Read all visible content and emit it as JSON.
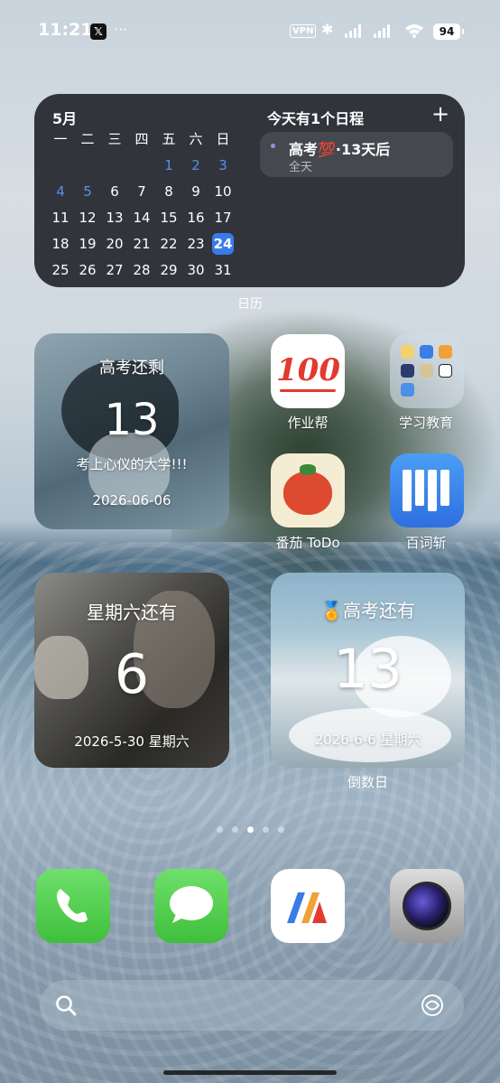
{
  "status_bar": {
    "time": "11:21",
    "x_badge": "𝕏",
    "more": "···",
    "vpn": "VPN",
    "battery": "94"
  },
  "calendar_widget": {
    "month": "5月",
    "weekdays": [
      "一",
      "二",
      "三",
      "四",
      "五",
      "六",
      "日"
    ],
    "weeks": [
      [
        "",
        "",
        "",
        "",
        "1",
        "2",
        "3"
      ],
      [
        "4",
        "5",
        "6",
        "7",
        "8",
        "9",
        "10"
      ],
      [
        "11",
        "12",
        "13",
        "14",
        "15",
        "16",
        "17"
      ],
      [
        "18",
        "19",
        "20",
        "21",
        "22",
        "23",
        "24"
      ],
      [
        "25",
        "26",
        "27",
        "28",
        "29",
        "30",
        "31"
      ]
    ],
    "today": "24",
    "schedule_title": "今天有1个日程",
    "add": "+",
    "event_title": "高考💯·13天后",
    "event_subtitle": "全天",
    "label": "日历"
  },
  "countdown_widget_1": {
    "title": "高考还剩",
    "number": "13",
    "subtitle": "考上心仪的大学!!!",
    "date": "2026-06-06"
  },
  "countdown_widget_2": {
    "title": "星期六还有",
    "number": "6",
    "date": "2026-5-30 星期六"
  },
  "countdown_widget_3": {
    "title": "🏅高考还有",
    "number": "13",
    "date": "2026-6-6 星期六",
    "label": "倒数日"
  },
  "apps": {
    "zuoyebang": {
      "label": "作业帮",
      "icon_text": "100"
    },
    "study_folder": {
      "label": "学习教育"
    },
    "tomato_todo": {
      "label": "番茄 ToDo"
    },
    "baicizhan": {
      "label": "百词斩"
    }
  },
  "dock": {
    "phone": "phone-icon",
    "messages": "messages-icon",
    "m_app": "m-app-icon",
    "camera": "camera-icon"
  },
  "colors": {
    "calendar_bg": "#23262c",
    "accent_blue": "#3a7bea",
    "weekend_blue": "#5a8fe8",
    "event_dot": "#9c8cf0",
    "dock_green": "#3fbf3c"
  }
}
